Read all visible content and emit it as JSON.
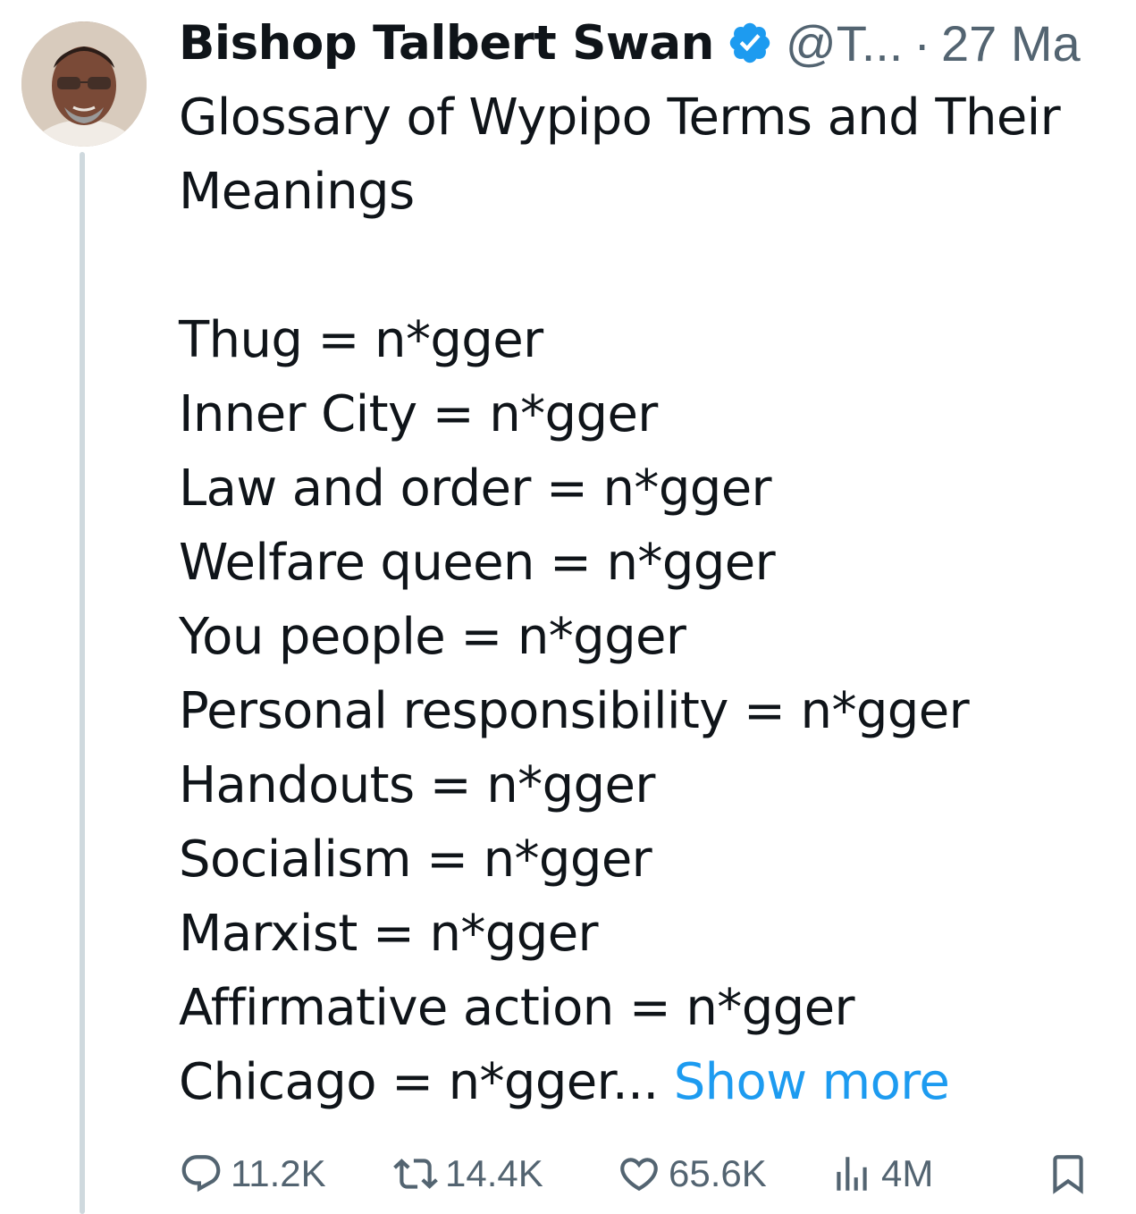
{
  "tweet": {
    "author_name": "Bishop Talbert Swan",
    "handle": "@T...",
    "separator": "·",
    "date": "27 Ma",
    "title_lines": [
      "Glossary of Wypipo Terms and Their",
      "Meanings"
    ],
    "lines": [
      "Thug = n*gger",
      "Inner City = n*gger",
      "Law and order = n*gger",
      "Welfare queen = n*gger",
      "You people = n*gger",
      "Personal responsibility = n*gger",
      "Handouts = n*gger",
      "Socialism = n*gger",
      "Marxist = n*gger",
      "Affirmative action = n*gger"
    ],
    "last_line": "Chicago = n*gger...",
    "show_more": "Show more",
    "replies": "11.2K",
    "retweets": "14.4K",
    "likes": "65.6K",
    "views": "4M",
    "colors": {
      "link": "#1d9bf0",
      "verified": "#1d9bf0",
      "muted": "#536471",
      "thread_line": "#cfd9de"
    },
    "icons": [
      "avatar",
      "verified-badge-icon",
      "reply-icon",
      "retweet-icon",
      "like-icon",
      "views-icon",
      "bookmark-icon"
    ]
  }
}
